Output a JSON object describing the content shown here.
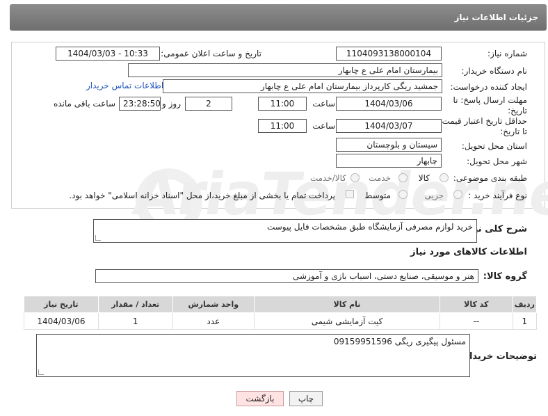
{
  "header": {
    "title": "جزئیات اطلاعات نیاز"
  },
  "fields": {
    "need_number_label": "شماره نیاز:",
    "need_number": "1104093138000104",
    "announce_label": "تاریخ و ساعت اعلان عمومی:",
    "announce_value": "1404/03/03 - 10:33",
    "buyer_org_label": "نام دستگاه خریدار:",
    "buyer_org": "بیمارستان امام علی  ع  چابهار",
    "creator_label": "ایجاد کننده درخواست:",
    "creator": "جمشید ریگی کارپرداز بیمارستان امام علی  ع  چابهار",
    "contact_link": "اطلاعات تماس خریدار",
    "deadline_label_1": "مهلت ارسال پاسخ: تا",
    "deadline_label_2": "تاریخ:",
    "deadline_date": "1404/03/06",
    "hour_label": "ساعت",
    "deadline_time": "11:00",
    "days_value": "2",
    "days_label": "روز و",
    "remaining_time": "23:28:50",
    "remaining_label": "ساعت باقی مانده",
    "validity_label_1": "حداقل تاریخ اعتبار قیمت:",
    "validity_label_2": "تا تاریخ:",
    "validity_date": "1404/03/07",
    "validity_hour_label": "ساعت",
    "validity_time": "11:00",
    "province_label": "استان محل تحویل:",
    "province": "سیستان و بلوچستان",
    "city_label": "شهر محل تحویل:",
    "city": "چابهار",
    "category_label": "طبقه بندی موضوعی:",
    "category_options": [
      "کالا",
      "خدمت",
      "کالا/خدمت"
    ],
    "process_label": "نوع فرآیند خرید :",
    "process_options": [
      "جزیی",
      "متوسط"
    ],
    "payment_note": "پرداخت تمام یا بخشی از مبلغ خرید،از محل \"اسناد خزانه اسلامی\" خواهد بود."
  },
  "description": {
    "label": "شرح کلی نیاز:",
    "value": "خرید لوازم مصرفی آزمایشگاه طبق مشخصات فایل پیوست"
  },
  "goods": {
    "section_title": "اطلاعات کالاهای مورد نیاز",
    "group_label": "گروه کالا:",
    "group_value": "هنر و موسیقی، صنایع دستی، اسباب بازی و آموزشی",
    "columns": [
      "ردیف",
      "کد کالا",
      "نام کالا",
      "واحد شمارش",
      "تعداد / مقدار",
      "تاریخ نیاز"
    ],
    "rows": [
      [
        "1",
        "--",
        "کیت آزمایشی شیمی",
        "عدد",
        "1",
        "1404/03/06"
      ]
    ]
  },
  "buyer_notes": {
    "label": "توضیحات خریدار:",
    "value": "مسئول پیگیری ریگی 09159951596"
  },
  "buttons": {
    "print": "چاپ",
    "back": "بازگشت"
  },
  "watermark": {
    "text": "AriaTender.net"
  }
}
